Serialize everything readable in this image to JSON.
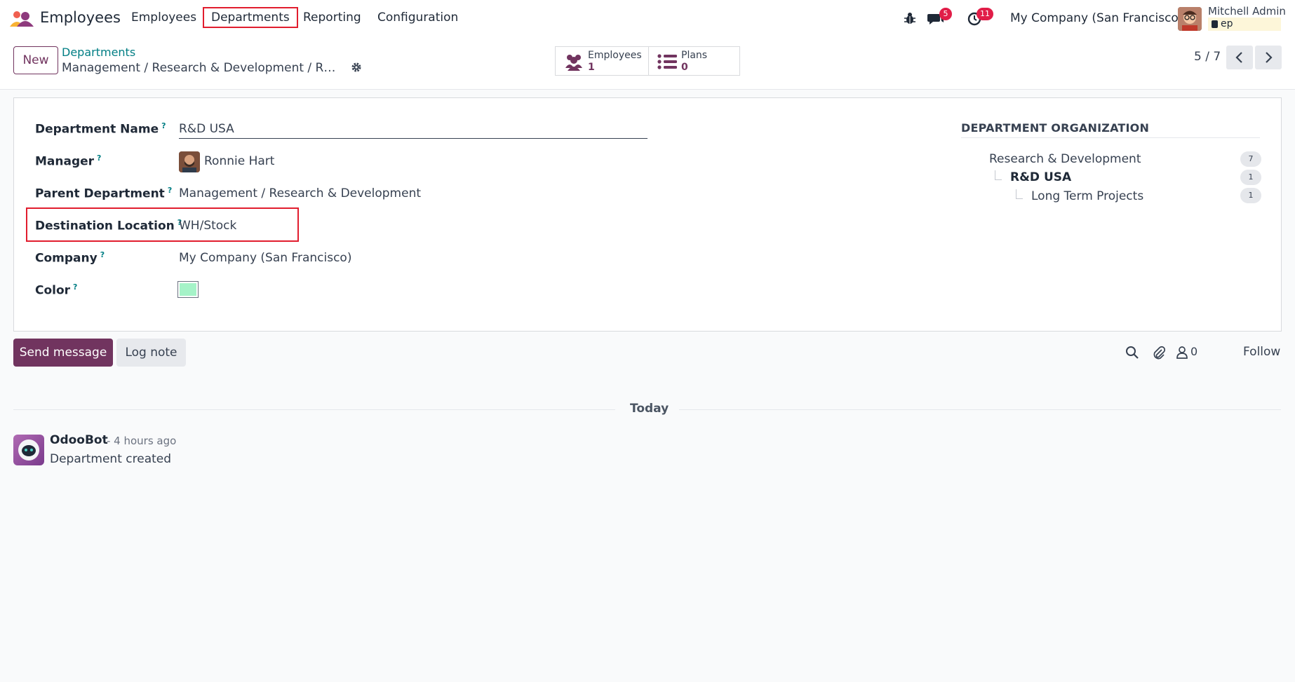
{
  "app": {
    "name": "Employees"
  },
  "menu": {
    "items": [
      "Employees",
      "Departments",
      "Reporting",
      "Configuration"
    ],
    "active": "Departments"
  },
  "systray": {
    "messages_badge": "5",
    "activities_badge": "11",
    "company": "My Company (San Francisco)",
    "user_name": "Mitchell Admin",
    "database": "ep"
  },
  "control_panel": {
    "new_label": "New",
    "breadcrumb_parent": "Departments",
    "breadcrumb_current": "Management / Research & Development / R&D USA",
    "smart_buttons": [
      {
        "label": "Employees",
        "count": "1"
      },
      {
        "label": "Plans",
        "count": "0"
      }
    ],
    "pager": "5 / 7"
  },
  "form": {
    "fields": {
      "department_name": {
        "label": "Department Name",
        "value": "R&D USA"
      },
      "manager": {
        "label": "Manager",
        "value": "Ronnie Hart"
      },
      "parent_department": {
        "label": "Parent Department",
        "value": "Management / Research & Development"
      },
      "destination_location": {
        "label": "Destination Location",
        "value": "WH/Stock"
      },
      "company": {
        "label": "Company",
        "value": "My Company (San Francisco)"
      },
      "color": {
        "label": "Color",
        "value": "#a5f3c8"
      }
    },
    "help_mark": "?",
    "organization": {
      "title": "DEPARTMENT ORGANIZATION",
      "items": [
        {
          "name": "Research & Development",
          "count": "7"
        },
        {
          "name": "R&D USA",
          "count": "1"
        },
        {
          "name": "Long Term Projects",
          "count": "1"
        }
      ]
    }
  },
  "chatter": {
    "send_label": "Send message",
    "log_label": "Log note",
    "followers_count": "0",
    "follow_label": "Follow",
    "date_separator": "Today",
    "messages": [
      {
        "author": "OdooBot",
        "time": "- 4 hours ago",
        "body": "Department created"
      }
    ]
  },
  "colors": {
    "brand": "#71345f",
    "link": "#017e84",
    "badge": "#e11d48",
    "highlight": "#e11d2e"
  }
}
